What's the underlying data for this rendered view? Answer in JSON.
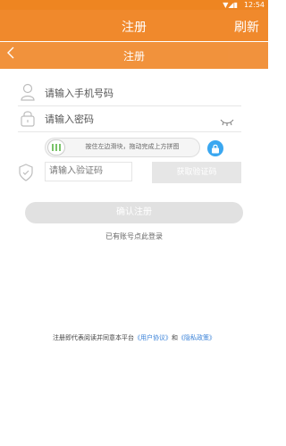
{
  "status_bar": {
    "time": "12:54",
    "icons": "▼◢▮"
  },
  "app_bar": {
    "title": "注册",
    "refresh_label": "刷新"
  },
  "sub_bar": {
    "back_icon": "chevron-left-icon",
    "title": "注册"
  },
  "form": {
    "phone_placeholder": "请输入手机号码",
    "password_placeholder": "请输入密码",
    "slider_text": "按住左边滑块，拖动完成上方拼图",
    "code_placeholder": "请输入验证码",
    "get_code_label": "获取验证码",
    "confirm_label": "确认注册",
    "login_link_label": "已有账号点此登录"
  },
  "footer": {
    "prefix": "注册即代表阅读并同意本平台",
    "user_agreement": "《用户协议》",
    "and_text": "和",
    "privacy_policy": "《隐私政策》"
  },
  "colors": {
    "brand": "#f0892c",
    "disabled": "#e1e1e1",
    "link": "#3a82d8",
    "lock": "#3aa7f0",
    "slider_grip": "#7ac36a"
  }
}
